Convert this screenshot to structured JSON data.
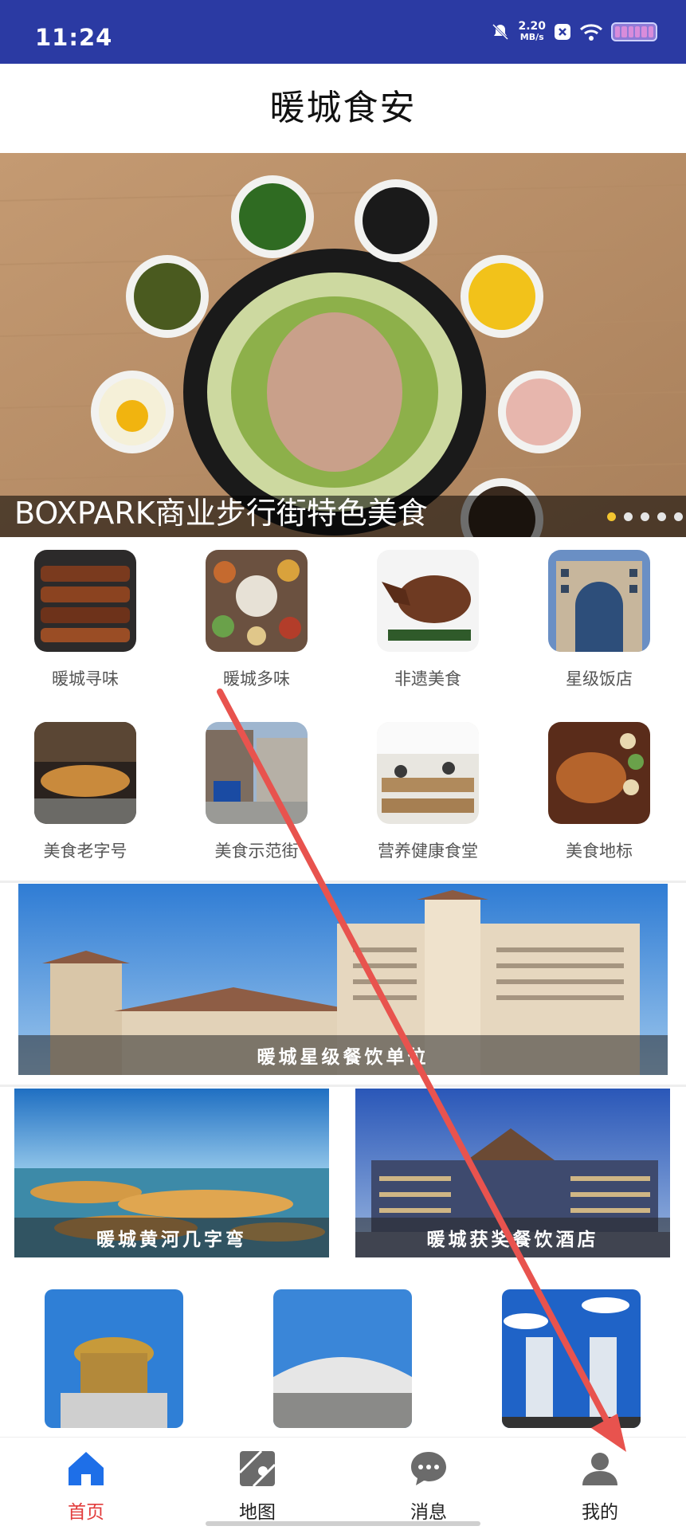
{
  "status_bar": {
    "time": "11:24",
    "network_speed_value": "2.20",
    "network_speed_unit": "MB/s"
  },
  "header": {
    "title": "暖城食安"
  },
  "banner": {
    "caption": "BOXPARK商业步行街特色美食",
    "slide_count": 5,
    "active_slide": 1
  },
  "categories": [
    {
      "label": "暖城寻味"
    },
    {
      "label": "暖城多味"
    },
    {
      "label": "非遗美食"
    },
    {
      "label": "星级饭店"
    },
    {
      "label": "美食老字号"
    },
    {
      "label": "美食示范街"
    },
    {
      "label": "营养健康食堂"
    },
    {
      "label": "美食地标"
    }
  ],
  "feature_cards": {
    "star_catering": "暖城星级餐饮单位",
    "yellow_river_bay": "暖城黄河几字弯",
    "award_hotels": "暖城获奖餐饮酒店"
  },
  "bottom_nav": [
    {
      "label": "首页",
      "icon": "home-icon",
      "active": true
    },
    {
      "label": "地图",
      "icon": "map-icon",
      "active": false
    },
    {
      "label": "消息",
      "icon": "message-icon",
      "active": false
    },
    {
      "label": "我的",
      "icon": "profile-icon",
      "active": false
    }
  ],
  "colors": {
    "status_bar": "#2b3aa3",
    "active_nav": "#1e6fe8",
    "active_label": "#e23c3c",
    "arrow": "#e8534e"
  }
}
